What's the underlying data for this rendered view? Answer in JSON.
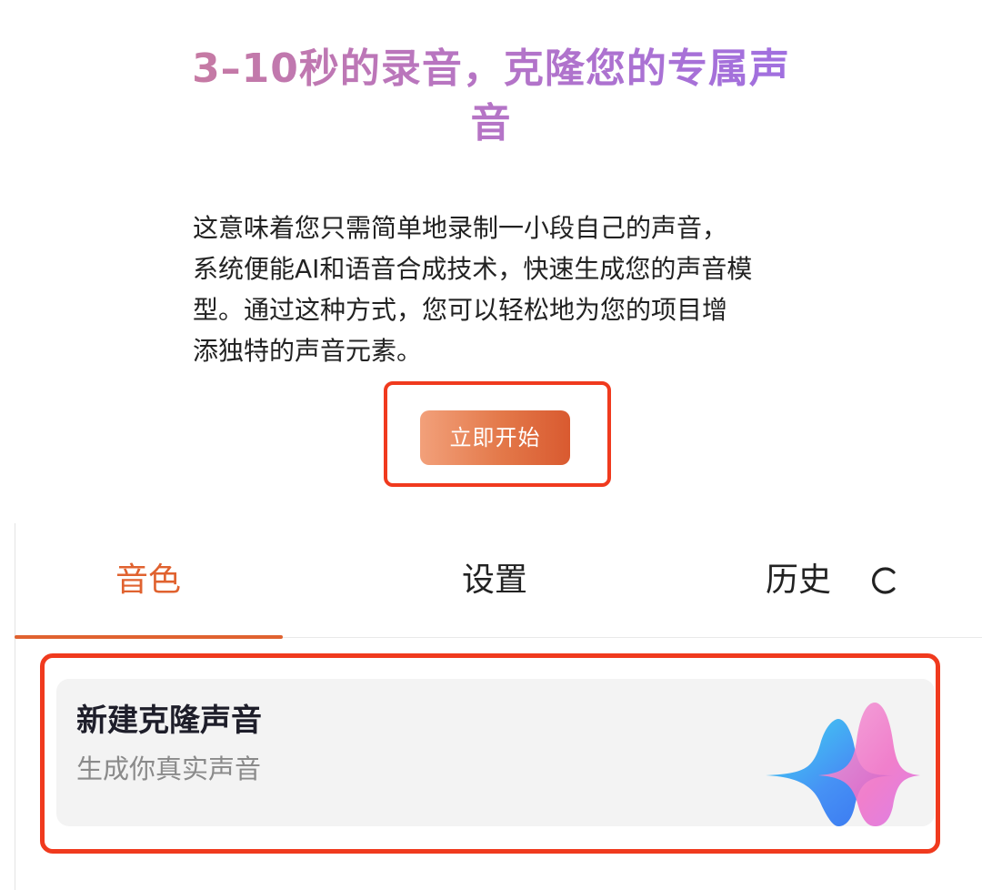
{
  "hero": {
    "title": "3–10秒的录音，克隆您的专属声音",
    "description_lines": [
      "这意味着您只需简单地录制一小段自己的声音，",
      "系统便能AI和语音合成技术，快速生成您的声音模",
      "型。通过这种方式，您可以轻松地为您的项目增",
      "添独特的声音元素。"
    ],
    "start_button_label": "立即开始"
  },
  "tabs": {
    "voice": "音色",
    "settings": "设置",
    "history": "历史",
    "active": "voice",
    "refresh_icon": "refresh-icon"
  },
  "clone_card": {
    "title": "新建克隆声音",
    "subtitle": "生成你真实声音",
    "icon": "sound-wave-icon"
  },
  "colors": {
    "accent": "#e0622f",
    "highlight_frame": "#f03a1e",
    "title_gradient_start": "#c67aa3",
    "title_gradient_end": "#a06fe0",
    "card_background": "#f3f3f3"
  }
}
